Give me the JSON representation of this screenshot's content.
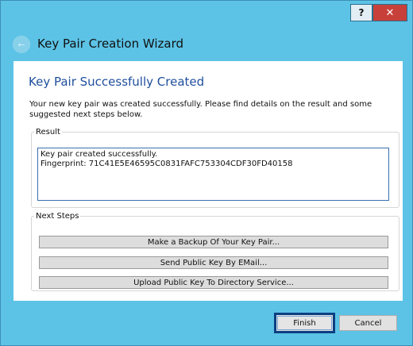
{
  "window": {
    "title": "Key Pair Creation Wizard",
    "help_label": "?",
    "close_label": "✕",
    "back_icon": "back-arrow-icon"
  },
  "page": {
    "heading": "Key Pair Successfully Created",
    "intro": "Your new key pair was created successfully. Please find details on the result and some suggested next steps below."
  },
  "result": {
    "legend": "Result",
    "lines": [
      "Key pair created successfully.",
      "Fingerprint: 71C41E5E46595C0831FAFC753304CDF30FD40158"
    ]
  },
  "next_steps": {
    "legend": "Next Steps",
    "buttons": [
      "Make a Backup Of Your Key Pair...",
      "Send Public Key By EMail...",
      "Upload Public Key To Directory Service..."
    ]
  },
  "footer": {
    "finish_label": "Finish",
    "cancel_label": "Cancel"
  },
  "colors": {
    "titlebar": "#5cc3e6",
    "heading": "#1f4e9c",
    "close_button": "#c7403a",
    "focus_border": "#0c3f82"
  }
}
